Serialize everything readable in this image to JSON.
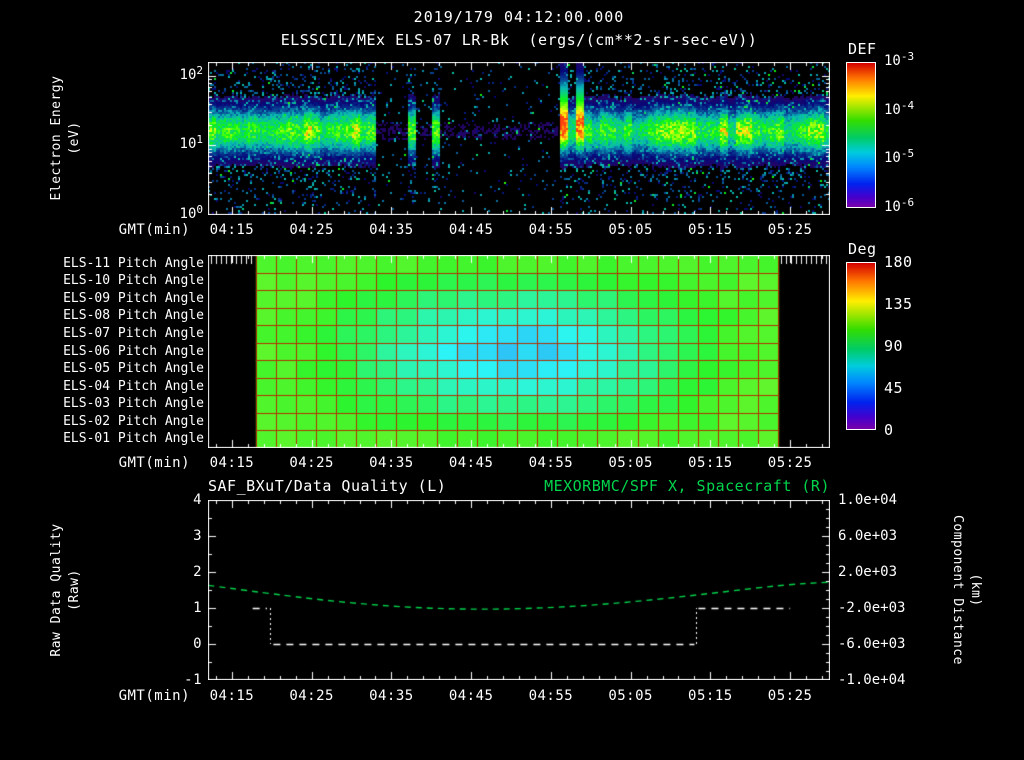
{
  "header": {
    "datetime": "2019/179 04:12:00.000",
    "instrument_title": "ELSSCIL/MEx ELS-07 LR-Bk  (ergs/(cm**2-sr-sec-eV))"
  },
  "labels": {
    "gmt": "GMT(min)"
  },
  "colors": {
    "background": "#000000",
    "foreground": "#ffffff",
    "accent_green": "#00d44c",
    "grid_red": "#b33000"
  },
  "panels": {
    "spectrogram": {
      "ylabel_line1": "Electron Energy",
      "ylabel_line2": "(eV)",
      "colorbar_label": "DEF"
    },
    "pitch": {
      "colorbar_label": "Deg"
    },
    "timeseries": {
      "left_title": "SAF_BXuT/Data Quality (L)",
      "right_title": "MEXORBMC/SPF X, Spacecraft (R)",
      "left_ylabel_line1": "Raw Data Quality",
      "left_ylabel_line2": "(Raw)",
      "right_ylabel_line1": "Component Distance",
      "right_ylabel_line2": "(km)"
    }
  },
  "chart_data": [
    {
      "id": "electron-energy-spectrogram",
      "type": "heatmap",
      "title": "ELSSCIL/MEx ELS-07 LR-Bk (ergs/(cm**2-sr-sec-eV))",
      "xlabel": "GMT(min)",
      "ylabel": "Electron Energy (eV)",
      "x_start": "04:12",
      "x_end": "05:30",
      "x_ticks": [
        "04:15",
        "04:25",
        "04:35",
        "04:45",
        "04:55",
        "05:05",
        "05:15",
        "05:25"
      ],
      "y_scale": "log",
      "ylim_ev": [
        1,
        158
      ],
      "y_ticks": [
        {
          "base": "10",
          "exp": "2"
        },
        {
          "base": "10",
          "exp": "1"
        },
        {
          "base": "10",
          "exp": "0"
        }
      ],
      "colorbar": {
        "label": "DEF",
        "units": "ergs/(cm**2-sr-sec-eV)",
        "ticks": [
          {
            "base": "10",
            "exp": "-3"
          },
          {
            "base": "10",
            "exp": "-4"
          },
          {
            "base": "10",
            "exp": "-5"
          },
          {
            "base": "10",
            "exp": "-6"
          }
        ]
      },
      "features": {
        "band_center_ev": 16,
        "band_sigma_decades": 0.22,
        "segments_min_from_start": [
          {
            "t0": 0,
            "t1": 21,
            "strength": 1.0,
            "note": "bright continuous 10-40 eV band"
          },
          {
            "t0": 21,
            "t1": 30,
            "strength": 0.35,
            "note": "intermittent band, bright vertical streaks"
          },
          {
            "t0": 30,
            "t1": 44,
            "strength": 0.06,
            "note": "dropout, sparse blue noise only"
          },
          {
            "t0": 44,
            "t1": 56,
            "strength": 0.9,
            "note": "band resumes, bursts up to ~100 eV"
          },
          {
            "t0": 56,
            "t1": 78,
            "strength": 1.0,
            "note": "bright continuous band"
          }
        ]
      }
    },
    {
      "id": "pitch-angle-grid",
      "type": "heatmap",
      "rows": [
        "ELS-11 Pitch Angle",
        "ELS-10 Pitch Angle",
        "ELS-09 Pitch Angle",
        "ELS-08 Pitch Angle",
        "ELS-07 Pitch Angle",
        "ELS-06 Pitch Angle",
        "ELS-05 Pitch Angle",
        "ELS-04 Pitch Angle",
        "ELS-03 Pitch Angle",
        "ELS-02 Pitch Angle",
        "ELS-01 Pitch Angle"
      ],
      "xlabel": "GMT(min)",
      "x_ticks": [
        "04:15",
        "04:25",
        "04:35",
        "04:45",
        "04:55",
        "05:05",
        "05:15",
        "05:25"
      ],
      "colorbar": {
        "label": "Deg",
        "ticks": [
          "180",
          "135",
          "90",
          "45",
          "0"
        ],
        "min": 0,
        "max": 180
      },
      "data_start_min": 6,
      "data_end_min": 71.5,
      "cell_minutes": 2.5,
      "angle_edge_deg": 108,
      "angle_center_deg": 52,
      "grid_color": "#b33000"
    },
    {
      "id": "quality-and-distance",
      "type": "line",
      "left_title": "SAF_BXuT/Data Quality (L)",
      "right_title": "MEXORBMC/SPF X, Spacecraft (R)",
      "xlabel": "GMT(min)",
      "x_ticks": [
        "04:15",
        "04:25",
        "04:35",
        "04:45",
        "04:55",
        "05:05",
        "05:15",
        "05:25"
      ],
      "left_axis": {
        "label": "Raw Data Quality (Raw)",
        "ticks": [
          "4",
          "3",
          "2",
          "1",
          "0",
          "-1"
        ],
        "min": -1,
        "max": 4
      },
      "right_axis": {
        "label": "Component Distance (km)",
        "ticks": [
          "1.0e+04",
          "6.0e+03",
          "2.0e+03",
          "-2.0e+03",
          "-6.0e+03",
          "-1.0e+04"
        ],
        "min": -10000,
        "max": 10000
      },
      "series": [
        {
          "name": "MEXORBMC/SPF X Spacecraft (right axis, km)",
          "axis": "right",
          "style": "dashed",
          "color": "#00d44c",
          "x_min": [
            0,
            8,
            16,
            24,
            32,
            40,
            48,
            56,
            64,
            72,
            78
          ],
          "y_km": [
            520,
            -440,
            -1280,
            -1880,
            -2160,
            -2080,
            -1720,
            -1080,
            -280,
            560,
            880
          ]
        },
        {
          "name": "SAF_BXuT Data Quality (left axis)",
          "axis": "left",
          "style": "dashed",
          "color": "#ffffff",
          "segments": [
            {
              "t0": 5.6,
              "t1": 7.4,
              "value": 1
            },
            {
              "t0": 8.2,
              "t1": 61.0,
              "value": 0
            },
            {
              "t0": 61.5,
              "t1": 73.0,
              "value": 1
            }
          ]
        }
      ]
    }
  ]
}
